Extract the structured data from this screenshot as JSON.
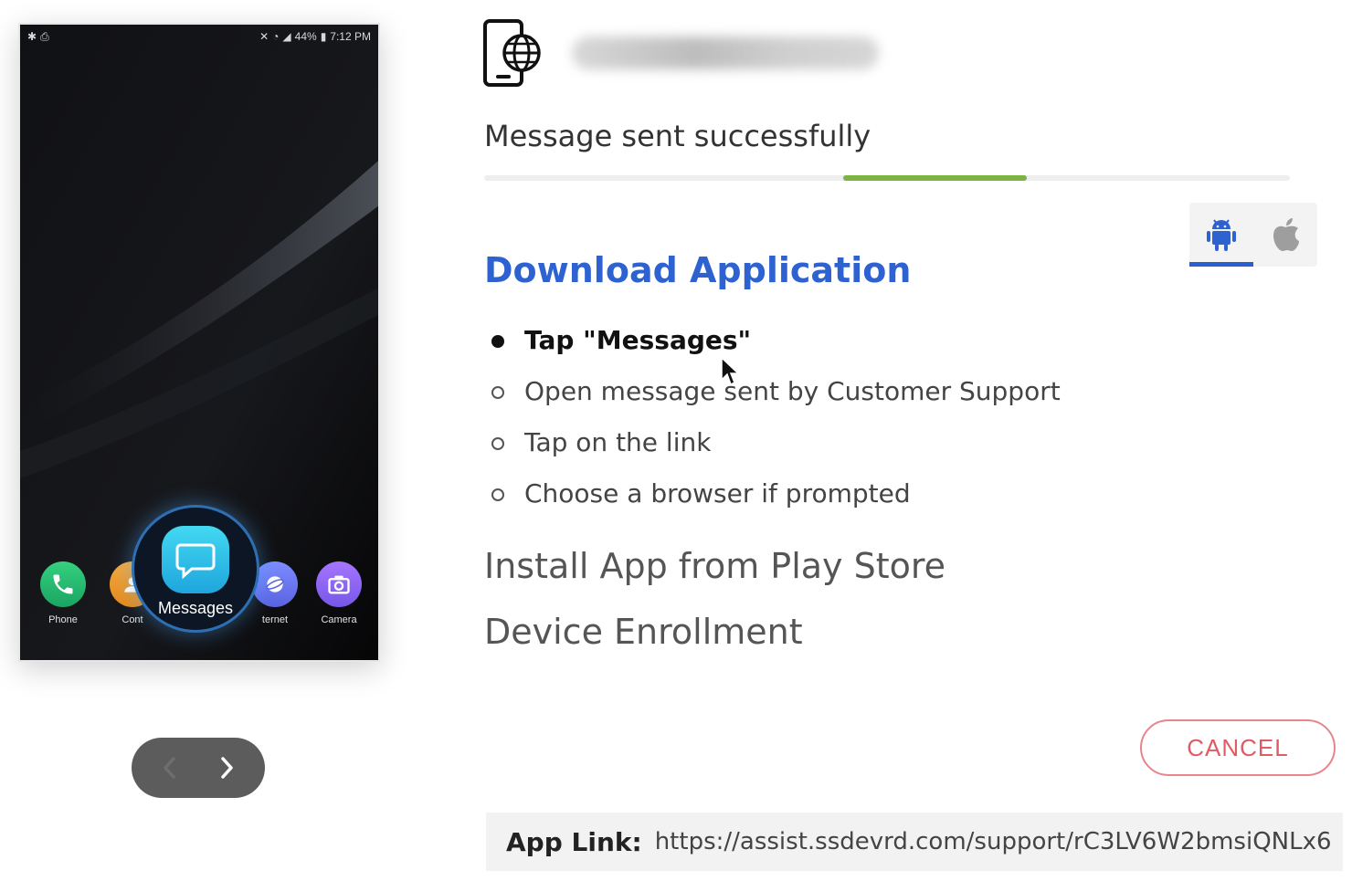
{
  "phone": {
    "status_time": "7:12 PM",
    "status_battery": "44%",
    "apps": [
      {
        "label": "Phone",
        "icon": "phone-icon"
      },
      {
        "label": "Cont",
        "icon": "contacts-icon"
      },
      {
        "label": "Messages",
        "icon": "messages-icon"
      },
      {
        "label": "ternet",
        "icon": "internet-icon"
      },
      {
        "label": "Camera",
        "icon": "camera-icon"
      }
    ]
  },
  "pager": {
    "prev_icon": "chevron-left-icon",
    "next_icon": "chevron-right-icon"
  },
  "header": {
    "device_icon": "mobile-globe-icon"
  },
  "status": {
    "text": "Message sent successfully",
    "progress_start": 0.446,
    "progress_end": 0.673,
    "color": "#7cb342"
  },
  "os_tabs": [
    {
      "icon": "android-icon",
      "active": true
    },
    {
      "icon": "apple-icon",
      "active": false
    }
  ],
  "section": {
    "title": "Download Application",
    "title_color": "#2f62d1",
    "steps": [
      "Tap \"Messages\"",
      "Open message sent by Customer Support",
      "Tap on the link",
      "Choose a browser if prompted"
    ]
  },
  "later_steps": [
    "Install App from Play Store",
    "Device Enrollment"
  ],
  "cancel_label": "CANCEL",
  "app_link": {
    "label": "App Link:",
    "url": "https://assist.ssdevrd.com/support/rC3LV6W2bmsiQNLx6"
  }
}
